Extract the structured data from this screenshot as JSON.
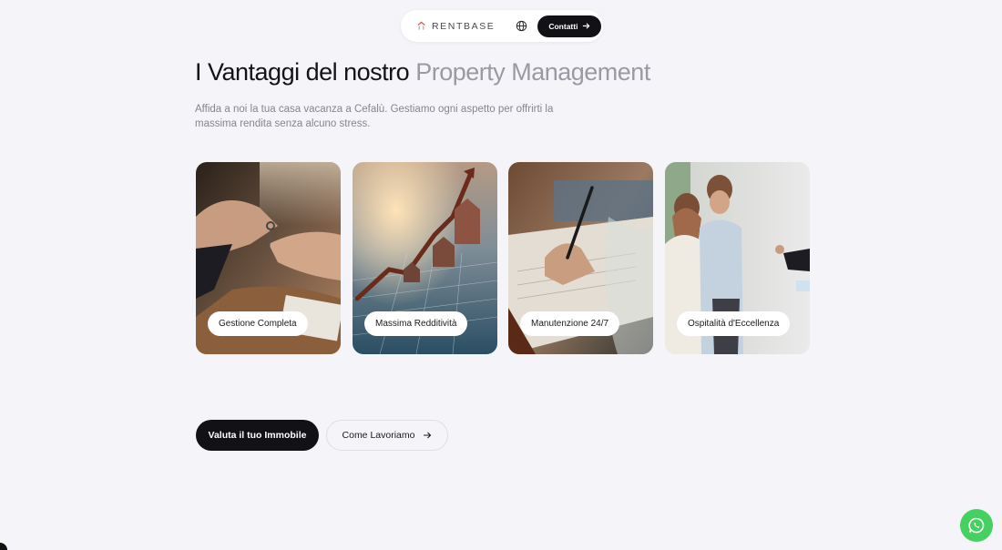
{
  "nav": {
    "brand": "RENTBASE",
    "contact_label": "Contatti",
    "icons": [
      "logo-mark-icon",
      "globe-icon",
      "arrow-right-icon"
    ]
  },
  "hero": {
    "title_dark": "I Vantaggi del nostro",
    "title_light": "Property Management",
    "subtitle": "Affida a noi la tua casa vacanza a Cefalù. Gestiamo ogni aspetto per offrirti la massima rendita senza alcuno stress."
  },
  "cards": [
    {
      "label": "Gestione Completa"
    },
    {
      "label": "Massima Redditività"
    },
    {
      "label": "Manutenzione 24/7"
    },
    {
      "label": "Ospitalità d'Eccellenza"
    }
  ],
  "cta": {
    "primary_label": "Valuta il tuo Immobile",
    "secondary_label": "Come Lavoriamo"
  },
  "colors": {
    "background": "#f4f4f9",
    "primary": "#121216",
    "accent_muted": "#9a9aa2",
    "whatsapp": "#44d160"
  }
}
